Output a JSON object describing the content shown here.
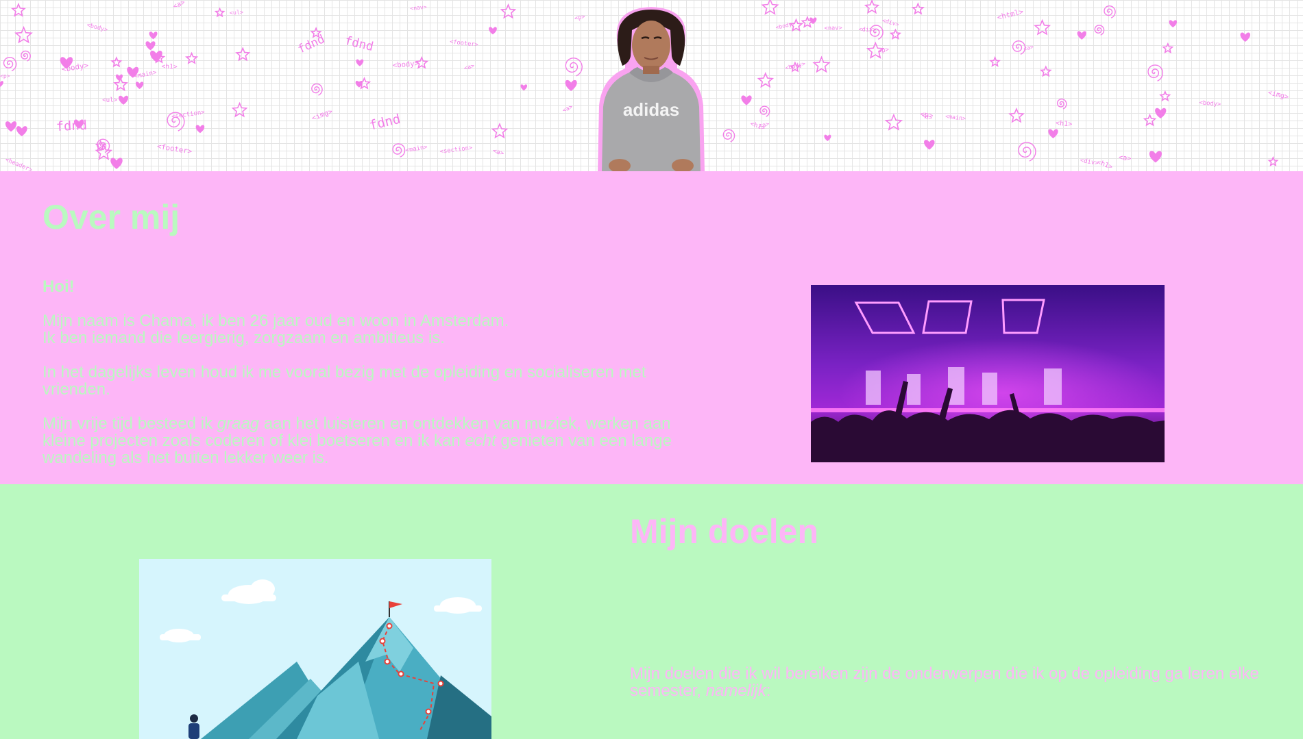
{
  "header": {
    "doodle_words": [
      "<main>",
      "fdnd",
      "<div>",
      "<header>",
      "<p>",
      "<img>",
      "<footer>",
      "<nav>",
      "<section>",
      "<body>",
      "<h1>",
      "<html>",
      "<a>",
      "<ul>"
    ],
    "portrait_alt": "Portretfoto",
    "portrait_shirt_text": "adidas"
  },
  "about": {
    "title": "Over mij",
    "greeting": "Hoi!",
    "p1_line1": "Mijn naam is Chama, ik ben 26 jaar oud en woon in Amsterdam.",
    "p1_line2": "Ik ben iemand die leergierig, zorgzaam en ambitieus is.",
    "p2": "In het dagelijks leven houd ik me vooral bezig met de opleiding en socialiseren met vrienden.",
    "p3_a": "Mijn vrije tijd besteed ik ",
    "p3_em1": "graag",
    "p3_b": " aan het luisteren en ontdekken van muziek, werken aan kleine projecten zoals coderen of klei boetseren en ik kan ",
    "p3_em2": "echt",
    "p3_c": " genieten van een lange wandeling als het buiten lekker weer is."
  },
  "goals": {
    "title": "Mijn doelen",
    "text_a": "Mijn doelen die ik wil bereiken zijn de onderwerpen die ik op de opleiding ga leren elke semester, ",
    "text_em": "namelijk",
    "text_b": ":"
  },
  "colors": {
    "pink": "#fdb6f7",
    "mint": "#baf9c0",
    "doodle_pink": "#f27ee8"
  }
}
